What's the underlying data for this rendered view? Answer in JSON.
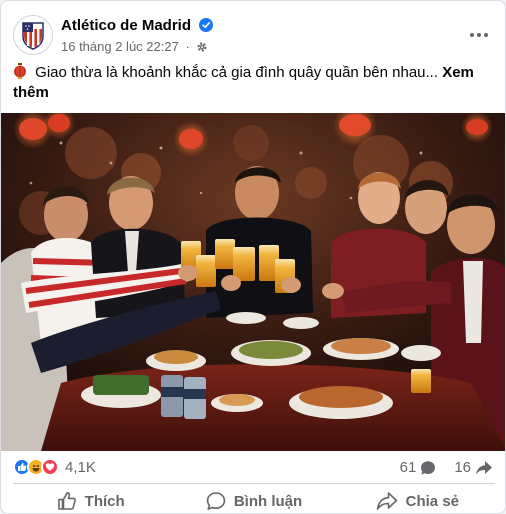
{
  "post": {
    "page_name": "Atlético de Madrid",
    "date": "16 tháng 2 lúc 22:27",
    "dot": "·",
    "text": "Giao thừa là khoảnh khắc cả gia đình quây quần bên nhau...",
    "see_more": "Xem thêm"
  },
  "stats": {
    "reactions_count": "4,1K",
    "comments_count": "61",
    "shares_count": "16"
  },
  "actions": {
    "like": "Thích",
    "comment": "Bình luận",
    "share": "Chia sẻ"
  },
  "colors": {
    "atletico_red": "#cb3524",
    "atletico_blue": "#272e61",
    "verified_blue": "#1877f2",
    "meta_gray": "#65676b"
  },
  "icons": [
    "atletico-crest-icon",
    "verified-icon",
    "gear-icon",
    "more-icon",
    "lantern-emoji-icon",
    "like-reaction-icon",
    "haha-reaction-icon",
    "love-reaction-icon",
    "comment-icon",
    "share-icon",
    "thumb-up-icon",
    "speech-bubble-icon",
    "share-arrow-icon"
  ]
}
